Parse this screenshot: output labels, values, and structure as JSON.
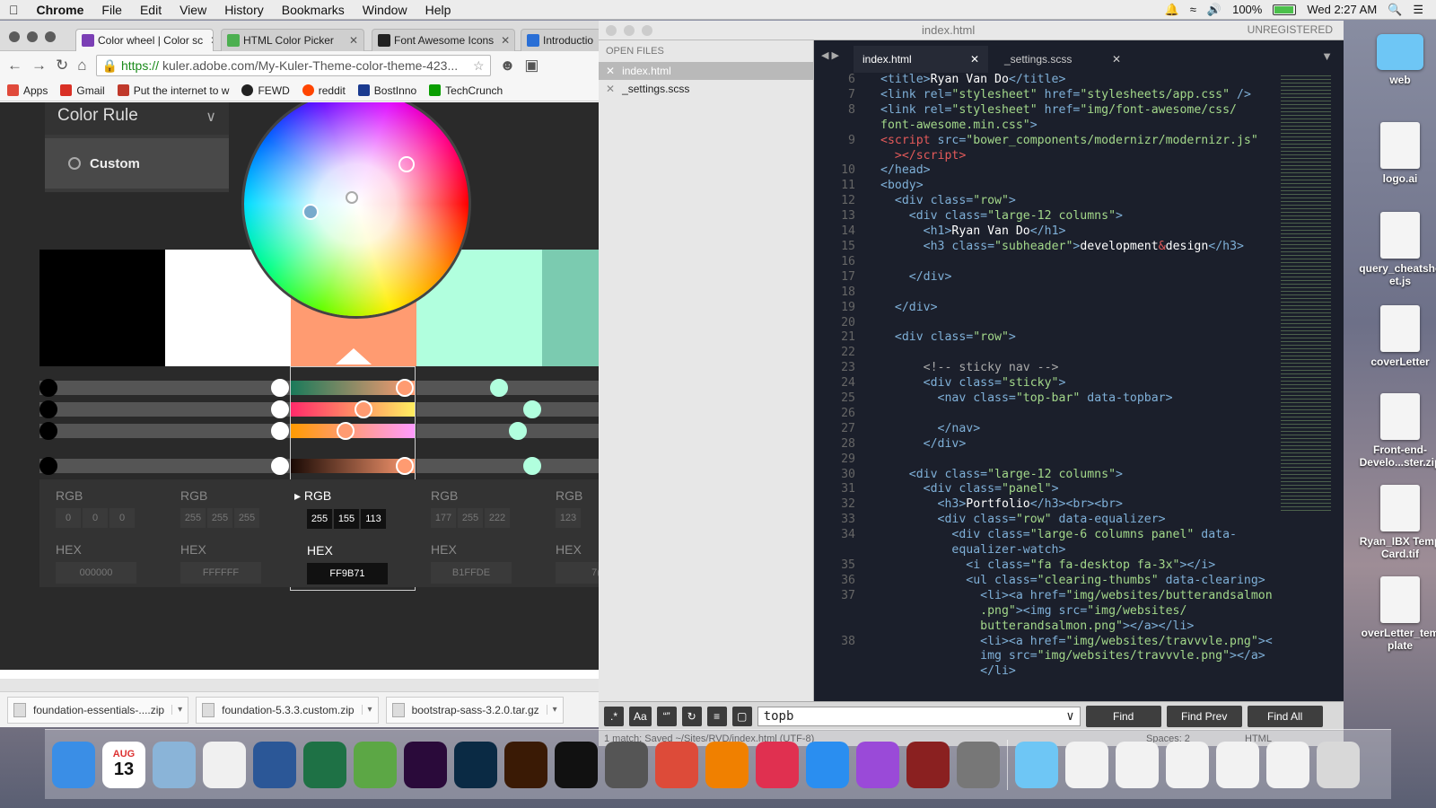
{
  "menubar": {
    "apple": "",
    "app": "Chrome",
    "items": [
      "File",
      "Edit",
      "View",
      "History",
      "Bookmarks",
      "Window",
      "Help"
    ],
    "battery": "100%",
    "clock": "Wed 2:27 AM"
  },
  "chrome": {
    "tabs": [
      {
        "label": "Color wheel | Color sc",
        "color": "#7b3fb5"
      },
      {
        "label": "HTML Color Picker",
        "color": "#4caf50"
      },
      {
        "label": "Font Awesome Icons",
        "color": "#222222"
      },
      {
        "label": "Introductio",
        "color": "#2a6fd6"
      }
    ],
    "url_https": "https://",
    "url_rest": "kuler.adobe.com/My-Kuler-Theme-color-theme-423...",
    "bookmarks": [
      {
        "label": "Apps",
        "color": "#e04a3b"
      },
      {
        "label": "Gmail",
        "color": "#d93025"
      },
      {
        "label": "Put the internet to w",
        "color": "#c0392b"
      },
      {
        "label": "FEWD",
        "color": "#222222"
      },
      {
        "label": "reddit",
        "color": "#ff4500"
      },
      {
        "label": "BostInno",
        "color": "#1a3a8f"
      },
      {
        "label": "TechCrunch",
        "color": "#0a9e01"
      }
    ],
    "downloads": [
      "foundation-essentials-....zip",
      "foundation-5.3.3.custom.zip",
      "bootstrap-sass-3.2.0.tar.gz"
    ]
  },
  "kuler": {
    "rule_title": "Color Rule",
    "rule_option": "Custom",
    "swatches": [
      "#000000",
      "#FFFFFF",
      "#FF9B71",
      "#B1FFDE",
      "#7BCBB0"
    ],
    "columns": [
      {
        "rgb_label": "RGB",
        "r": "0",
        "g": "0",
        "b": "0",
        "hex_label": "HEX",
        "hex": "000000"
      },
      {
        "rgb_label": "RGB",
        "r": "255",
        "g": "255",
        "b": "255",
        "hex_label": "HEX",
        "hex": "FFFFFF"
      },
      {
        "rgb_label": "RGB",
        "r": "255",
        "g": "155",
        "b": "113",
        "hex_label": "HEX",
        "hex": "FF9B71"
      },
      {
        "rgb_label": "RGB",
        "r": "177",
        "g": "255",
        "b": "222",
        "hex_label": "HEX",
        "hex": "B1FFDE"
      },
      {
        "rgb_label": "RGB",
        "r": "123",
        "g": "",
        "b": "",
        "hex_label": "HEX",
        "hex": "7("
      }
    ]
  },
  "sublime": {
    "title": "index.html",
    "unregistered": "UNREGISTERED",
    "open_files_label": "OPEN FILES",
    "open_files": [
      "index.html",
      "_settings.scss"
    ],
    "tabs": [
      "index.html",
      "_settings.scss"
    ],
    "line_numbers": [
      "6",
      "7",
      "8",
      "",
      "9",
      "",
      "10",
      "11",
      "12",
      "13",
      "14",
      "15",
      "16",
      "17",
      "18",
      "19",
      "20",
      "21",
      "22",
      "23",
      "24",
      "25",
      "26",
      "27",
      "28",
      "29",
      "30",
      "31",
      "32",
      "33",
      "34",
      "",
      "35",
      "36",
      "37",
      "",
      "",
      "38",
      "",
      ""
    ],
    "find_value": "topb",
    "find_buttons": [
      "Find",
      "Find Prev",
      "Find All"
    ],
    "status_left": "1 match; Saved ~/Sites/RVD/index.html (UTF-8)",
    "status_spaces": "Spaces: 2",
    "status_syntax": "HTML"
  },
  "desktop": {
    "icons": [
      "web",
      "logo.ai",
      "query_cheatshe et.js",
      "coverLetter",
      "Front-end-Develo...ster.zip",
      "Ryan_IBX Temp Card.tif",
      "overLetter_tem plate"
    ]
  },
  "dock": {
    "apps": [
      {
        "name": "Finder",
        "color": "#3a8ee6"
      },
      {
        "name": "Calendar",
        "color": "#ffffff"
      },
      {
        "name": "Preview",
        "color": "#8ab4d8"
      },
      {
        "name": "TextEdit",
        "color": "#f0f0f0"
      },
      {
        "name": "Word",
        "color": "#2b5797"
      },
      {
        "name": "Excel",
        "color": "#1e7145"
      },
      {
        "name": "Evernote",
        "color": "#5ca745"
      },
      {
        "name": "Premiere",
        "color": "#2a0a3a"
      },
      {
        "name": "Photoshop",
        "color": "#0a2a44"
      },
      {
        "name": "Illustrator",
        "color": "#3a1a05"
      },
      {
        "name": "Terminal",
        "color": "#111111"
      },
      {
        "name": "Sublime",
        "color": "#555555"
      },
      {
        "name": "Chrome",
        "color": "#dd4b39"
      },
      {
        "name": "VLC",
        "color": "#f08000"
      },
      {
        "name": "iTunes",
        "color": "#e03050"
      },
      {
        "name": "App Store",
        "color": "#2a8ef0"
      },
      {
        "name": "Podcasts",
        "color": "#9a4ad8"
      },
      {
        "name": "Dictionary",
        "color": "#8a2020"
      },
      {
        "name": "System Preferences",
        "color": "#777777"
      }
    ],
    "calendar_month": "AUG",
    "calendar_day": "13"
  }
}
